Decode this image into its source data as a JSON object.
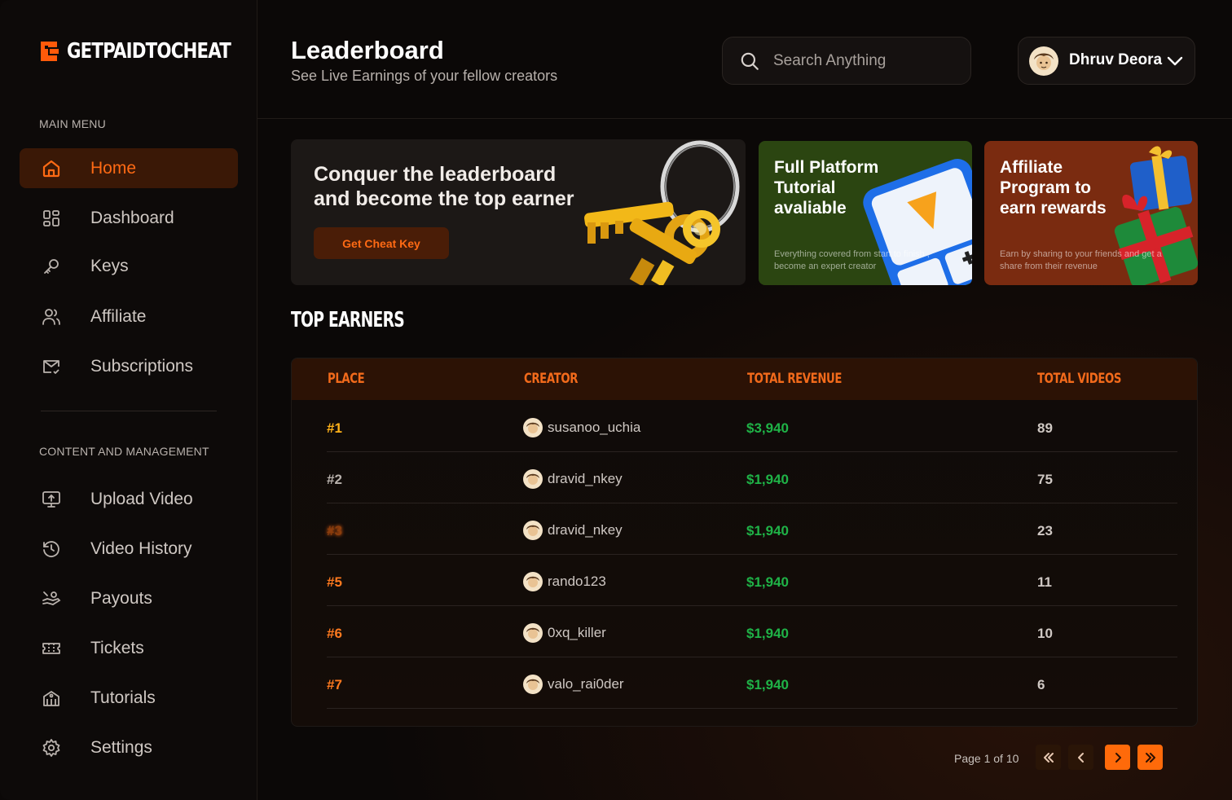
{
  "brand": {
    "name": "GETPAIDTOCHEAT",
    "accent": "#ff6a14"
  },
  "sidebar": {
    "main_menu_label": "MAIN MENU",
    "content_label": "CONTENT AND MANAGEMENT",
    "main_items": [
      {
        "label": "Home",
        "icon": "home-icon",
        "active": true
      },
      {
        "label": "Dashboard",
        "icon": "dashboard-icon"
      },
      {
        "label": "Keys",
        "icon": "key-icon"
      },
      {
        "label": "Affiliate",
        "icon": "users-icon"
      },
      {
        "label": "Subscriptions",
        "icon": "mail-check-icon"
      }
    ],
    "content_items": [
      {
        "label": "Upload Video",
        "icon": "upload-monitor-icon"
      },
      {
        "label": "Video History",
        "icon": "history-icon"
      },
      {
        "label": "Payouts",
        "icon": "payout-icon"
      },
      {
        "label": "Tickets",
        "icon": "ticket-icon"
      },
      {
        "label": "Tutorials",
        "icon": "tutorial-icon"
      },
      {
        "label": "Settings",
        "icon": "gear-icon"
      }
    ]
  },
  "header": {
    "title": "Leaderboard",
    "subtitle": "See Live Earnings of your fellow creators",
    "search_placeholder": "Search Anything",
    "user_name": "Dhruv Deora"
  },
  "banners": {
    "main": {
      "title": "Conquer the leaderboard and become the top earner",
      "cta": "Get Cheat Key"
    },
    "tutorial": {
      "title": "Full Platform Tutorial avaliable",
      "desc": "Everything covered from start to finish , become an expert creator"
    },
    "affiliate": {
      "title": "Affiliate Program to earn rewards",
      "desc": "Earn by sharing to your friends and get a share from their revenue"
    }
  },
  "leaderboard": {
    "title": "TOP EARNERS",
    "columns": [
      "PLACE",
      "CREATOR",
      "TOTAL REVENUE",
      "TOTAL VIDEOS"
    ],
    "rows": [
      {
        "place": "#1",
        "creator": "susanoo_uchia",
        "revenue": "$3,940",
        "videos": "89"
      },
      {
        "place": "#2",
        "creator": "dravid_nkey",
        "revenue": "$1,940",
        "videos": "75"
      },
      {
        "place": "#3",
        "creator": "dravid_nkey",
        "revenue": "$1,940",
        "videos": "23"
      },
      {
        "place": "#5",
        "creator": "rando123",
        "revenue": "$1,940",
        "videos": "11"
      },
      {
        "place": "#6",
        "creator": "0xq_killer",
        "revenue": "$1,940",
        "videos": "10"
      },
      {
        "place": "#7",
        "creator": "valo_rai0der",
        "revenue": "$1,940",
        "videos": "6"
      }
    ]
  },
  "pagination": {
    "label": "Page 1 of 10"
  },
  "colors": {
    "accent": "#ff6a14",
    "revenue": "#1fb347",
    "gold": "#ffb21a"
  }
}
